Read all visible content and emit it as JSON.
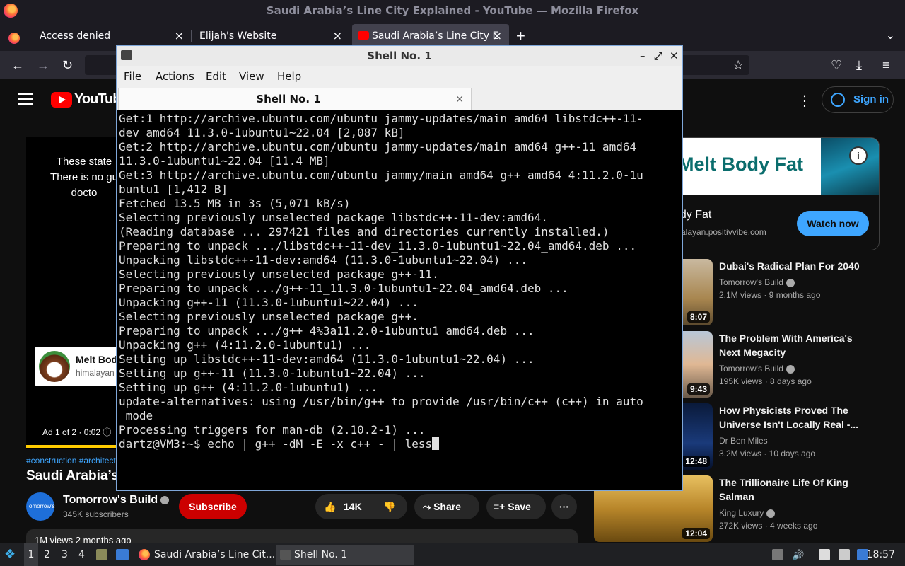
{
  "window": {
    "title": "Saudi Arabia’s Line City Explained - YouTube — Mozilla Firefox"
  },
  "tabs": [
    {
      "label": "Access denied",
      "active": false
    },
    {
      "label": "Elijah's Website",
      "active": false
    },
    {
      "label": "Saudi Arabia’s Line City E",
      "active": true
    }
  ],
  "toolbar": {
    "new_tab": "+",
    "tab_list": "⌄",
    "back": "←",
    "forward": "→",
    "reload": "↻",
    "bookmark": "☆",
    "pocket": "♡",
    "downloads": "⤓",
    "menu": "≡"
  },
  "youtube": {
    "logo": "YouTube",
    "sign_in": "Sign in",
    "player_text": "These state There is no gu docto",
    "ad_card": {
      "title": "Melt Bod",
      "domain": "himalayan"
    },
    "ad_label": "Ad 1 of 2 · 0:02 ⓘ",
    "tags": "#construction #architect",
    "video_title": "Saudi Arabia’s L",
    "channel": {
      "name": "Tomorrow's Build",
      "subscribers": "345K subscribers",
      "avatar_text": "Tomorrow's Build"
    },
    "subscribe": "Subscribe",
    "likes": "14K",
    "share": "Share",
    "save": "Save",
    "more": "···",
    "description": "1M views  2 months ago",
    "side_ad": {
      "headline": "Melt Body Fat",
      "title": "ody Fat",
      "domain": "malayan.positivvibe.com",
      "cta": "Watch now",
      "info": "i"
    },
    "recommendations": [
      {
        "title": "Dubai's Radical Plan For 2040",
        "channel": "Tomorrow's Build",
        "meta": "2.1M views · 9 months ago",
        "duration": "8:07"
      },
      {
        "title": "The Problem With America's Next Megacity",
        "channel": "Tomorrow's Build",
        "meta": "195K views · 8 days ago",
        "duration": "9:43"
      },
      {
        "title": "How Physicists Proved The Universe Isn't Locally Real -...",
        "channel": "Dr Ben Miles",
        "meta": "3.2M views · 10 days ago",
        "duration": "12:48"
      },
      {
        "title": "The Trillionaire Life Of King Salman",
        "channel": "King Luxury",
        "meta": "272K views · 4 weeks ago",
        "duration": "12:04"
      }
    ]
  },
  "terminal": {
    "title": "Shell No. 1",
    "menu": [
      "File",
      "Actions",
      "Edit",
      "View",
      "Help"
    ],
    "tab_label": "Shell No. 1",
    "lines": [
      "Get:1 http://archive.ubuntu.com/ubuntu jammy-updates/main amd64 libstdc++-11-",
      "dev amd64 11.3.0-1ubuntu1~22.04 [2,087 kB]",
      "Get:2 http://archive.ubuntu.com/ubuntu jammy-updates/main amd64 g++-11 amd64",
      "11.3.0-1ubuntu1~22.04 [11.4 MB]",
      "Get:3 http://archive.ubuntu.com/ubuntu jammy/main amd64 g++ amd64 4:11.2.0-1u",
      "buntu1 [1,412 B]",
      "Fetched 13.5 MB in 3s (5,071 kB/s)",
      "Selecting previously unselected package libstdc++-11-dev:amd64.",
      "(Reading database ... 297421 files and directories currently installed.)",
      "Preparing to unpack .../libstdc++-11-dev_11.3.0-1ubuntu1~22.04_amd64.deb ...",
      "Unpacking libstdc++-11-dev:amd64 (11.3.0-1ubuntu1~22.04) ...",
      "Selecting previously unselected package g++-11.",
      "Preparing to unpack .../g++-11_11.3.0-1ubuntu1~22.04_amd64.deb ...",
      "Unpacking g++-11 (11.3.0-1ubuntu1~22.04) ...",
      "Selecting previously unselected package g++.",
      "Preparing to unpack .../g++_4%3a11.2.0-1ubuntu1_amd64.deb ...",
      "Unpacking g++ (4:11.2.0-1ubuntu1) ...",
      "Setting up libstdc++-11-dev:amd64 (11.3.0-1ubuntu1~22.04) ...",
      "Setting up g++-11 (11.3.0-1ubuntu1~22.04) ...",
      "Setting up g++ (4:11.2.0-1ubuntu1) ...",
      "update-alternatives: using /usr/bin/g++ to provide /usr/bin/c++ (c++) in auto",
      " mode",
      "Processing triggers for man-db (2.10.2-1) ..."
    ],
    "prompt": "dartz@VM3:~$ echo | g++ -dM -E -x c++ - | less"
  },
  "taskbar": {
    "workspaces": [
      "1",
      "2",
      "3",
      "4"
    ],
    "windows": [
      {
        "label": "Saudi Arabia’s Line Cit...",
        "active": false
      },
      {
        "label": "Shell No. 1",
        "active": true
      }
    ],
    "clock": "18:57"
  }
}
